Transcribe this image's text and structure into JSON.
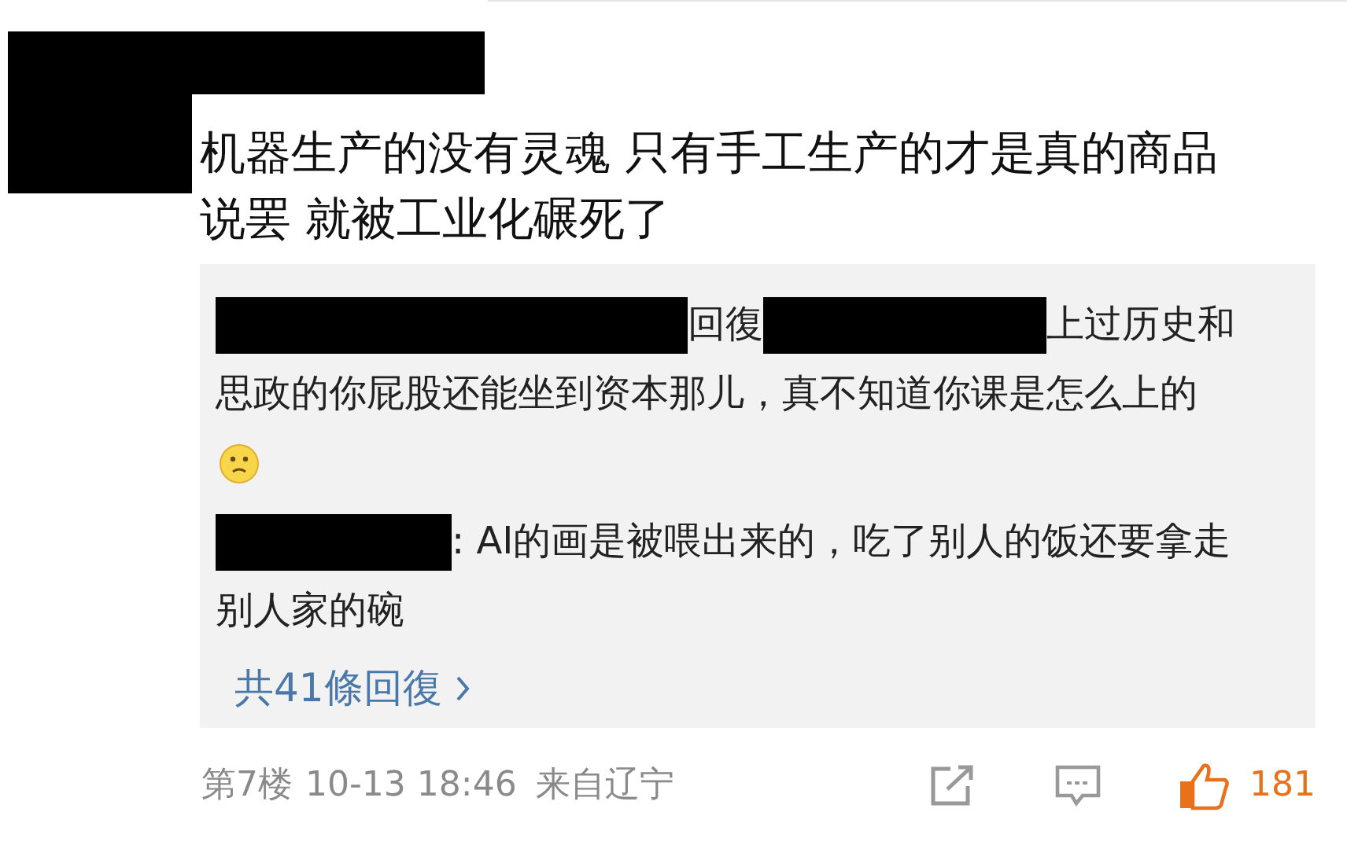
{
  "comment": {
    "text": "机器生产的没有灵魂 只有手工生产的才是真的商品说罢 就被工业化碾死了"
  },
  "replies": [
    {
      "kind": "reply_to",
      "reply_word": "回復",
      "text": "上过历史和思政的你屁股还能坐到资本那儿，真不知道你课是怎么上的",
      "emoji": true
    },
    {
      "kind": "plain",
      "text": ": AI的画是被喂出来的，吃了别人的饭还要拿走别人家的碗",
      "emoji": false
    }
  ],
  "more_replies": "共41條回復",
  "footer": {
    "floor": "第7楼",
    "time": "10-13 18:46",
    "location": "来自辽宁",
    "likes": "181",
    "liked": true
  }
}
